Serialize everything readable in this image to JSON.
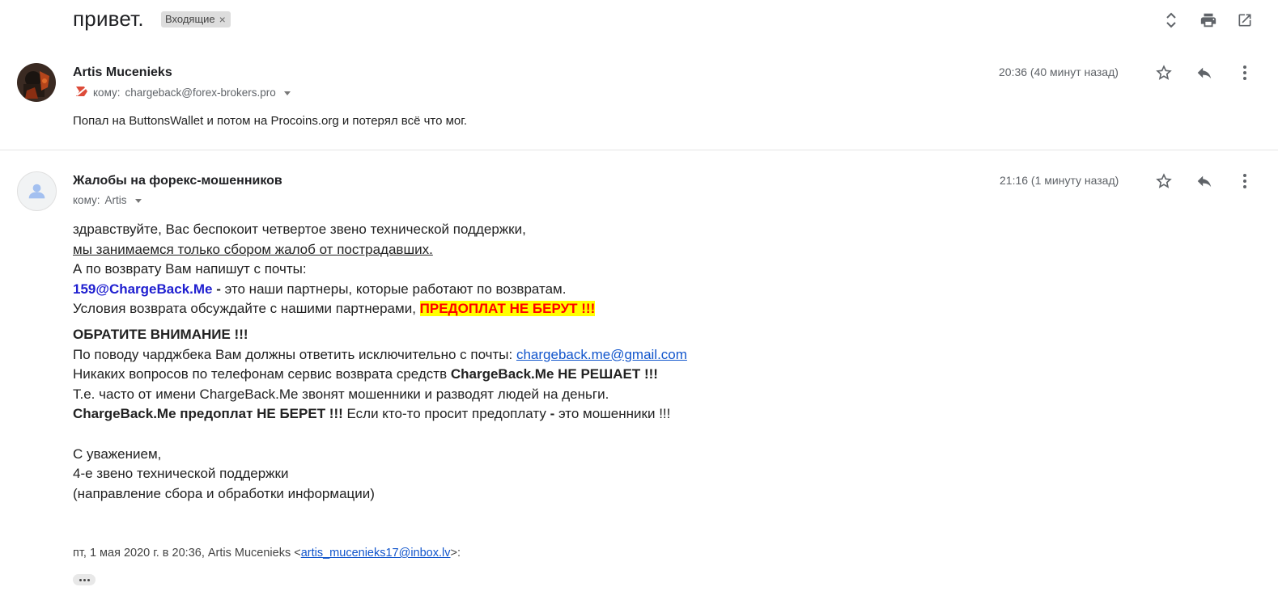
{
  "thread": {
    "subject": "привет.",
    "label": "Входящие",
    "label_remove": "×",
    "toolbar_icons": [
      "expand-collapse-icon",
      "print-icon",
      "open-in-new-window-icon"
    ]
  },
  "messages": [
    {
      "sender": "Artis Mucenieks",
      "to_prefix": "кому:",
      "to": "chargeback@forex-brokers.pro",
      "time": "20:36 (40 минут назад)",
      "snippet": "Попал на ButtonsWallet и потом на Procoins.org и потерял всё что мог."
    },
    {
      "sender": "Жалобы на форекс-мошенников",
      "to_prefix": "кому:",
      "to": "Artis",
      "time": "21:16 (1 минуту назад)",
      "body": {
        "l1": "здравствуйте, Вас беспокоит четвертое звено технической поддержки,",
        "l2": "мы занимаемся только сбором жалоб от пострадавших.",
        "l3": "А по возврату Вам напишут с почты:",
        "l4_email": "159@ChargeBack.Me",
        "l4_dash": " - ",
        "l4_rest": "это наши партнеры, которые работают по возвратам.",
        "l5_text": "Условия возврата обсуждайте с нашими партнерами, ",
        "l5_highlight": "ПРЕДОПЛАТ НЕ БЕРУТ !!!",
        "l6": "ОБРАТИТЕ ВНИМАНИЕ !!!",
        "l7_text": "По поводу чарджбека Вам должны ответить исключительно с почты: ",
        "l7_link": "chargeback.me@gmail.com",
        "l8_text": "Никаких вопросов по телефонам сервис возврата средств ",
        "l8_bold": "ChargeBack.Me НЕ РЕШАЕТ !!!",
        "l9": "Т.е. часто от имени ChargeBack.Me звонят мошенники и разводят людей на деньги.",
        "l10_bold": "ChargeBack.Me предоплат НЕ БЕРЕТ !!!",
        "l10_text": " Если кто-то просит предоплату ",
        "l10_dash": "-",
        "l10_end": " это мошенники !!!",
        "sig1": "С уважением,",
        "sig2": "4-е звено технической поддержки",
        "sig3": "(направление сбора и обработки информации)"
      },
      "quote_prefix": "пт, 1 мая 2020 г. в 20:36, Artis Mucenieks <",
      "quote_email": "artis_mucenieks17@inbox.lv",
      "quote_suffix": ">:"
    }
  ],
  "colors": {
    "highlight_bg": "#ffff00",
    "highlight_text": "#ff0000",
    "link": "#1155cc",
    "partner_email": "#1f1fd0"
  }
}
